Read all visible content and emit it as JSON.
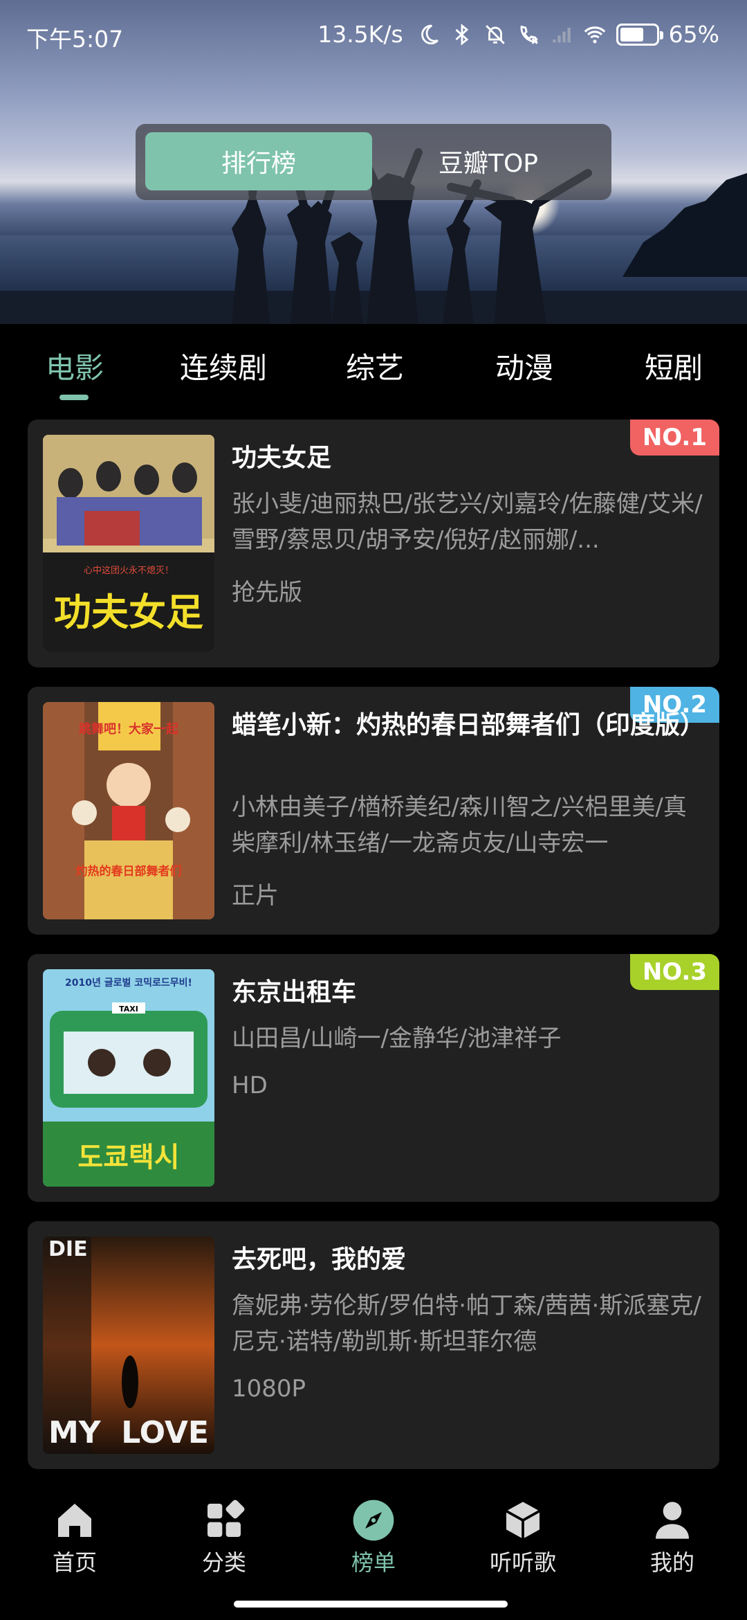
{
  "status_bar": {
    "time": "下午5:07",
    "net_speed": "13.5K/s",
    "battery": "65%",
    "battery_level": 0.65
  },
  "segment": {
    "options": [
      "排行榜",
      "豆瓣TOP"
    ],
    "selected": "排行榜"
  },
  "tabs": {
    "items": [
      "电影",
      "连续剧",
      "综艺",
      "动漫",
      "短剧"
    ],
    "selected": "电影"
  },
  "colors": {
    "accent": "#7fc3ad",
    "badge_1": "#f16262",
    "badge_2": "#4fb3e3",
    "badge_3": "#a8d12a"
  },
  "ranking": [
    {
      "rank": "NO.1",
      "title": "功夫女足",
      "cast": "张小斐/迪丽热巴/张艺兴/刘嘉玲/佐藤健/艾米/雪野/蔡思贝/胡予安/倪好/赵丽娜/...",
      "quality": "抢先版"
    },
    {
      "rank": "NO.2",
      "title": "蜡笔小新：灼热的春日部舞者们（印度版）",
      "cast": "小林由美子/楢桥美纪/森川智之/兴梠里美/真柴摩利/林玉绪/一龙斋贞友/山寺宏一",
      "quality": "正片"
    },
    {
      "rank": "NO.3",
      "title": "东京出租车",
      "cast": "山田昌/山崎一/金静华/池津祥子",
      "quality": "HD"
    },
    {
      "rank": "",
      "title": "去死吧，我的爱",
      "cast": "詹妮弗·劳伦斯/罗伯特·帕丁森/茜茜·斯派塞克/尼克·诺特/勒凯斯·斯坦菲尔德",
      "quality": "1080P"
    }
  ],
  "posters": {
    "p1": {
      "top_text": "心中这团火永不熄灭！",
      "big_text": "功夫女足"
    },
    "p2": {
      "top_text": "跳舞吧！大家一起",
      "big_text": "灼热的春日部舞者们"
    },
    "p3": {
      "top_text": "2010년 글로벌 코믹로드무비!",
      "sign": "TAXI",
      "big_text": "도쿄택시"
    },
    "p4": {
      "top_text": "DIE",
      "left_word": "MY",
      "right_word": "LOVE"
    }
  },
  "bottom_nav": {
    "items": [
      {
        "label": "首页",
        "icon": "home-icon"
      },
      {
        "label": "分类",
        "icon": "category-icon"
      },
      {
        "label": "榜单",
        "icon": "compass-icon"
      },
      {
        "label": "听听歌",
        "icon": "box-icon"
      },
      {
        "label": "我的",
        "icon": "user-icon"
      }
    ],
    "selected": "榜单"
  }
}
